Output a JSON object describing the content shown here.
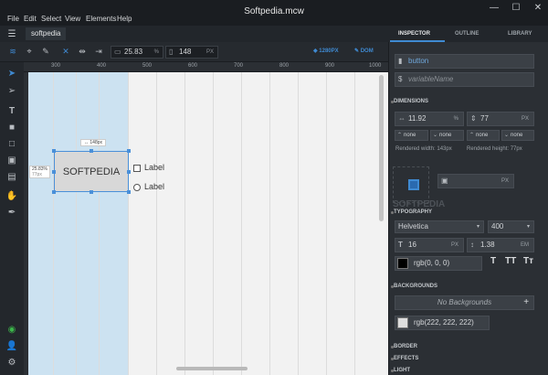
{
  "window": {
    "title": "Softpedia.mcw",
    "controls": [
      "—",
      "☐",
      "✕"
    ]
  },
  "menu": [
    "File",
    "Edit",
    "Select",
    "View",
    "Elements",
    "Help"
  ],
  "doc_tab": "softpedia",
  "toolbar": {
    "width_value": "25.83",
    "width_unit": "%",
    "height_value": "148",
    "height_unit": "PX",
    "breakpoint_label": "1280PX",
    "dom_label": "DOM"
  },
  "ruler": {
    "marks": [
      "300",
      "400",
      "500",
      "600",
      "700",
      "800",
      "900",
      "1000"
    ]
  },
  "canvas": {
    "button_text": "SOFTPEDIA",
    "width_tip": "↔ 148px",
    "height_tip_pct": "25.83%",
    "height_tip_px": "77px",
    "checkbox_label": "Label",
    "radio_label": "Label"
  },
  "inspector": {
    "tabs": [
      "INSPECTOR",
      "OUTLINE",
      "LIBRARY"
    ],
    "active_tab": "INSPECTOR",
    "element_type": "button",
    "variable_placeholder": "variableName",
    "dimensions": {
      "header": "DIMENSIONS",
      "width_value": "11.92",
      "width_unit": "%",
      "height_value": "77",
      "height_unit": "PX",
      "min_max": [
        "none",
        "none",
        "none",
        "none"
      ],
      "rendered_width": "Rendered width: 143px",
      "rendered_height": "Rendered height: 77px"
    },
    "position_unit": "PX",
    "watermark": "SOFTPEDIA",
    "typography": {
      "header": "TYPOGRAPHY",
      "font": "Helvetica",
      "weight": "400",
      "size": "16",
      "size_unit": "PX",
      "line_height": "1.38",
      "line_unit": "EM",
      "color": "rgb(0, 0, 0)",
      "style_buttons": [
        "T",
        "TT",
        "Tт"
      ]
    },
    "backgrounds": {
      "header": "BACKGROUNDS",
      "empty_text": "No Backgrounds",
      "color": "rgb(222, 222, 222)",
      "add": "+"
    },
    "sections_collapsed": [
      "BORDER",
      "EFFECTS",
      "LIGHT"
    ]
  },
  "colors": {
    "accent": "#3f8ad2",
    "panel": "#2b2f34",
    "canvas": "#f2f2f2",
    "button_bg": "#dedede"
  }
}
